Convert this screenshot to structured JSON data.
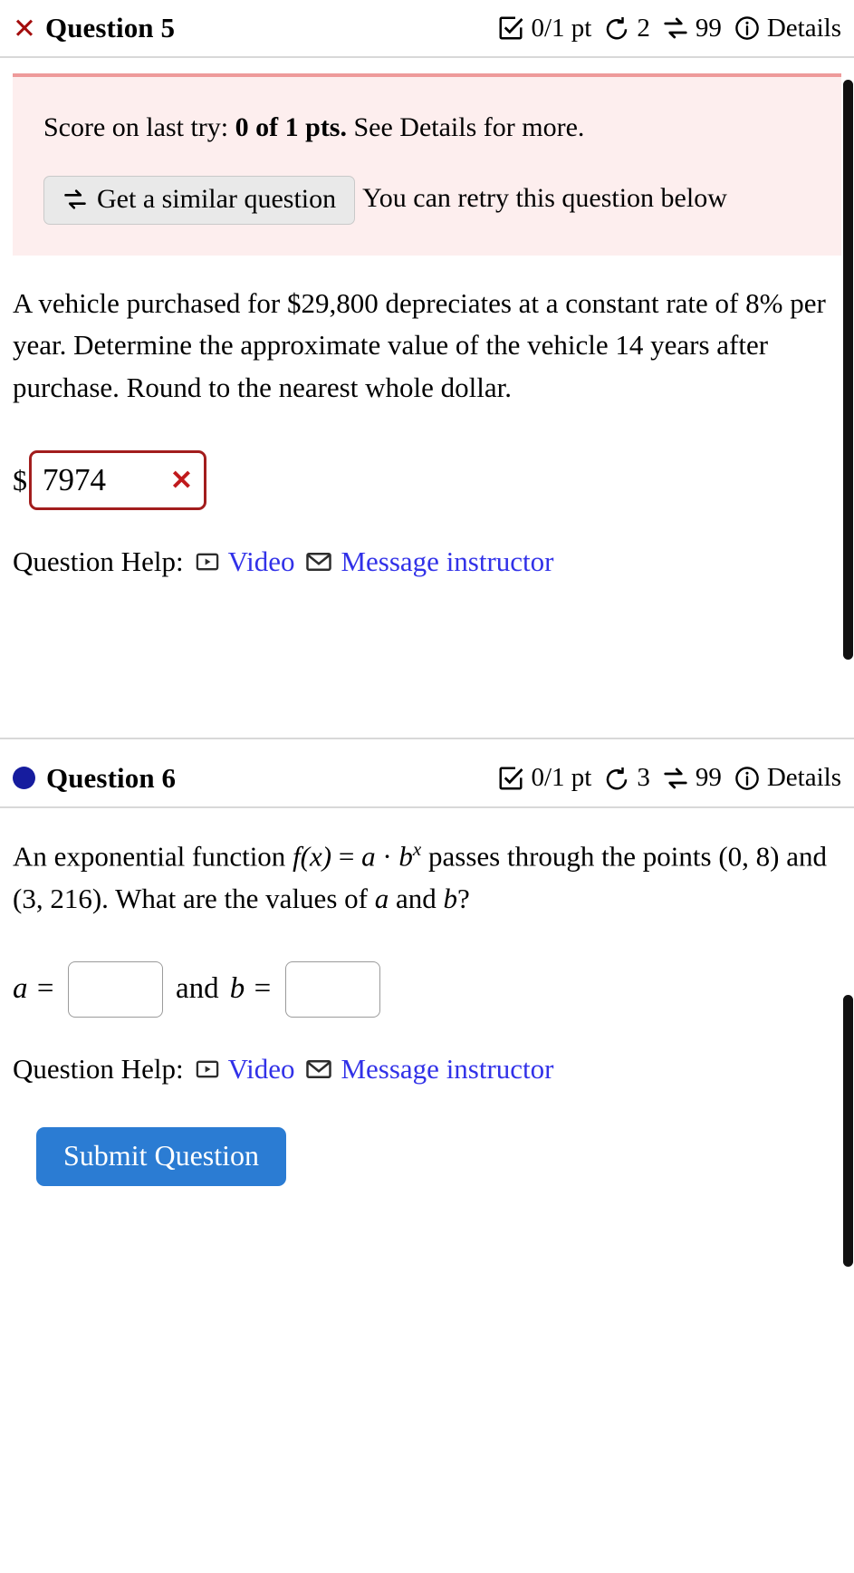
{
  "colors": {
    "accent_blue": "#2b7cd3",
    "link_blue": "#3131e8",
    "error_red": "#a21d1d",
    "alert_bg": "#fdeeee",
    "alert_border": "#ee9a9a",
    "dot_blue": "#161c9e"
  },
  "question5": {
    "status_mark": "incorrect-x",
    "title": "Question 5",
    "score": "0/1 pt",
    "attempts": "2",
    "similar": "99",
    "details_label": "Details",
    "icons": {
      "score": "checkbox-icon",
      "attempts": "undo-arrow-icon",
      "similar": "swap-arrows-icon",
      "details": "info-circle-icon"
    },
    "alert": {
      "lead": "Score on last try:",
      "score_bold": "0 of 1 pts.",
      "trail": "See Details for more.",
      "similar_button": "Get a similar question",
      "retry_text": "You can retry this question below"
    },
    "prompt": "A vehicle purchased for $29,800 depreciates at a constant rate of 8% per year. Determine the approximate value of the vehicle 14 years after purchase. Round to the nearest whole dollar.",
    "answer": {
      "prefix": "$",
      "value": "7974",
      "status": "incorrect",
      "status_glyph": "✕"
    },
    "help": {
      "label": "Question Help:",
      "video": "Video",
      "message": "Message instructor"
    }
  },
  "question6": {
    "status_mark": "blue-dot",
    "title": "Question 6",
    "score": "0/1 pt",
    "attempts": "3",
    "similar": "99",
    "details_label": "Details",
    "prompt_part1": "An exponential function ",
    "math_f": "f(x)",
    "math_eq": "=",
    "math_a": "a",
    "math_dot": "·",
    "math_b": "b",
    "math_x": "x",
    "prompt_part2": " passes through the points (0, 8) and (3, 216). What are the values of ",
    "prompt_a": "a",
    "prompt_and": " and ",
    "prompt_b": "b",
    "prompt_qmark": "?",
    "answer": {
      "a_label": "a =",
      "a_value": "",
      "and_label": "and",
      "b_label": "b =",
      "b_value": ""
    },
    "help": {
      "label": "Question Help:",
      "video": "Video",
      "message": "Message instructor"
    },
    "submit_label": "Submit Question"
  }
}
